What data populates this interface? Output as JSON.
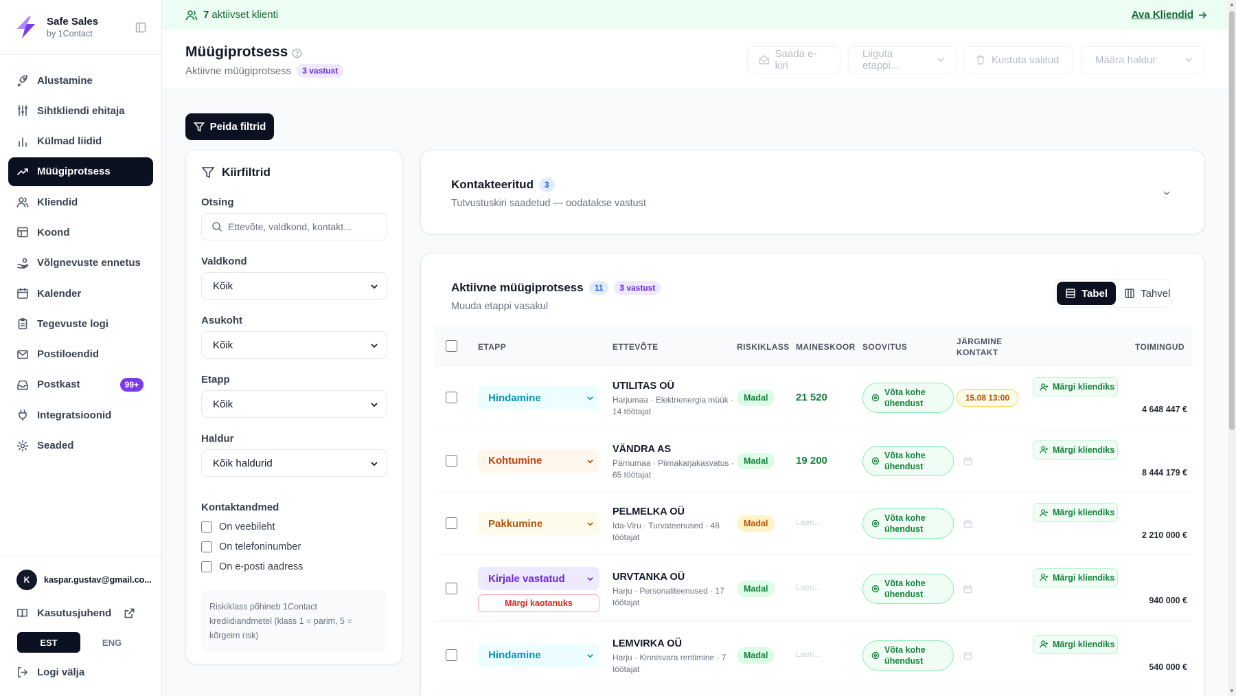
{
  "brand": {
    "name": "Safe Sales",
    "sub": "by 1Contact"
  },
  "nav": [
    {
      "label": "Alustamine",
      "icon": "rocket-icon"
    },
    {
      "label": "Sihtkliendi ehitaja",
      "icon": "sliders-icon"
    },
    {
      "label": "Külmad liidid",
      "icon": "bar-chart-icon"
    },
    {
      "label": "Müügiprotsess",
      "icon": "trending-up-icon",
      "active": true
    },
    {
      "label": "Kliendid",
      "icon": "users-icon"
    },
    {
      "label": "Koond",
      "icon": "table-icon"
    },
    {
      "label": "Võlgnevuste ennetus",
      "icon": "hand-coins-icon"
    },
    {
      "label": "Kalender",
      "icon": "calendar-icon"
    },
    {
      "label": "Tegevuste logi",
      "icon": "clipboard-icon"
    },
    {
      "label": "Postiloendid",
      "icon": "mail-icon"
    },
    {
      "label": "Postkast",
      "icon": "inbox-icon",
      "badge": "99+"
    },
    {
      "label": "Integratsioonid",
      "icon": "plug-icon"
    },
    {
      "label": "Seaded",
      "icon": "gear-icon"
    }
  ],
  "user": {
    "initial": "K",
    "email": "kaspar.gustav@gmail.co..."
  },
  "guide_label": "Kasutusjuhend",
  "lang": {
    "est": "EST",
    "eng": "ENG"
  },
  "logout_label": "Logi välja",
  "banner": {
    "count": "7",
    "text": "aktiivset klienti",
    "link": "Ava Kliendid"
  },
  "header": {
    "title": "Müügiprotsess",
    "subtitle": "Aktiivne müügiprotsess",
    "badge": "3 vastust",
    "send_email": "Saada e-kiri",
    "move_stage": "Liiguta etappi...",
    "delete_selected": "Kustuta valitud",
    "assign_owner": "Määra haldur"
  },
  "filter_toggle": "Peida filtrid",
  "filters": {
    "title": "Kiirfiltrid",
    "search_label": "Otsing",
    "search_placeholder": "Ettevõte, valdkond, kontakt...",
    "industry_label": "Valdkond",
    "industry_value": "Kõik",
    "location_label": "Asukoht",
    "location_value": "Kõik",
    "stage_label": "Etapp",
    "stage_value": "Kõik",
    "owner_label": "Haldur",
    "owner_value": "Kõik haldurid",
    "contact_label": "Kontaktandmed",
    "has_website": "On veebileht",
    "has_phone": "On telefoninumber",
    "has_email": "On e-posti aadress",
    "note": "Riskiklass põhineb 1Contact krediidiandmetel (klass 1 = parim, 5 = kõrgeim risk)"
  },
  "contacted": {
    "title": "Kontakteeritud",
    "count": "3",
    "subtitle": "Tutvustuskiri saadetud — oodatakse vastust"
  },
  "pipeline": {
    "title": "Aktiivne müügiprotsess",
    "count": "11",
    "badge": "3 vastust",
    "subtitle": "Muuda etappi vasakul",
    "view_table": "Tabel",
    "view_board": "Tahvel",
    "columns": {
      "stage": "ETAPP",
      "company": "ETTEVÕTE",
      "risk": "RISKIKLASS",
      "score": "MAINESKOOR",
      "suggestion": "SOOVITUS",
      "next_contact": "JÄRGMINE KONTAKT",
      "actions": "TOIMINGUD"
    },
    "rows": [
      {
        "stage": "Hindamine",
        "stage_color": "#0891b2",
        "stage_bg": "#ecfeff",
        "company": "UTILITAS OÜ",
        "meta": "Harjumaa · Elektrienergia müük · 14 töötajat",
        "risk": "Madal",
        "risk_color": "#15803d",
        "risk_bg": "#dcfce7",
        "score": "21 520",
        "suggestion": "Võta kohe ühendust",
        "next_contact": "15.08 13:00",
        "action": "Märgi kliendiks",
        "amount": "4 648 447 €"
      },
      {
        "stage": "Kohtumine",
        "stage_color": "#c2410c",
        "stage_bg": "#fff7ed",
        "company": "VÄNDRA AS",
        "meta": "Pärnumaa · Piimakarjakasvatus · 65 töötajat",
        "risk": "Madal",
        "risk_color": "#15803d",
        "risk_bg": "#dcfce7",
        "score": "19 200",
        "suggestion": "Võta kohe ühendust",
        "next_contact": "",
        "action": "Märgi kliendiks",
        "amount": "8 444 179 €"
      },
      {
        "stage": "Pakkumine",
        "stage_color": "#b45309",
        "stage_bg": "#fffbeb",
        "company": "PELMELKA OÜ",
        "meta": "Ida-Viru · Turvateenused · 48 töötajat",
        "risk": "Madal",
        "risk_color": "#b45309",
        "risk_bg": "#fef3c7",
        "score": "Laen...",
        "suggestion": "Võta kohe ühendust",
        "next_contact": "",
        "action": "Märgi kliendiks",
        "amount": "2 210 000 €"
      },
      {
        "stage": "Kirjale vastatud",
        "stage_color": "#6d28d9",
        "stage_bg": "#ede9fe",
        "company": "URVTANKA OÜ",
        "meta": "Harju · Personaliteenused · 17 töötajat",
        "risk": "Madal",
        "risk_color": "#15803d",
        "risk_bg": "#dcfce7",
        "score": "Laen...",
        "suggestion": "Võta kohe ühendust",
        "next_contact": "",
        "action": "Märgi kliendiks",
        "amount": "940 000 €",
        "lost_label": "Märgi kaotanuks"
      },
      {
        "stage": "Hindamine",
        "stage_color": "#0891b2",
        "stage_bg": "#ecfeff",
        "company": "LEMVIRKA OÜ",
        "meta": "Harju · Kinnisvara rentimine · 7 töötajat",
        "risk": "Madal",
        "risk_color": "#15803d",
        "risk_bg": "#dcfce7",
        "score": "Laen...",
        "suggestion": "Võta kohe ühendust",
        "next_contact": "",
        "action": "Märgi kliendiks",
        "amount": "540 000 €"
      }
    ]
  }
}
